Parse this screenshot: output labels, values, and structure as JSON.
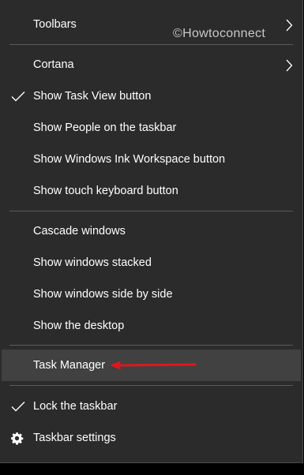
{
  "watermark": "©Howtoconnect",
  "menu": {
    "toolbars": "Toolbars",
    "cortana": "Cortana",
    "show_task_view": "Show Task View button",
    "show_people": "Show People on the taskbar",
    "show_ink_workspace": "Show Windows Ink Workspace button",
    "show_touch_keyboard": "Show touch keyboard button",
    "cascade_windows": "Cascade windows",
    "show_stacked": "Show windows stacked",
    "show_side_by_side": "Show windows side by side",
    "show_desktop": "Show the desktop",
    "task_manager": "Task Manager",
    "lock_taskbar": "Lock the taskbar",
    "taskbar_settings": "Taskbar settings"
  },
  "checked": {
    "show_task_view": true,
    "lock_taskbar": true
  },
  "highlighted_item": "task_manager",
  "colors": {
    "menu_background": "#2b2b2b",
    "highlight": "#414141",
    "text": "#ffffff",
    "annotation_arrow": "#e0161b"
  },
  "icons": {
    "check": "checkmark-icon",
    "submenu": "chevron-right-icon",
    "settings": "gear-icon",
    "annotation": "red-arrow-icon"
  }
}
